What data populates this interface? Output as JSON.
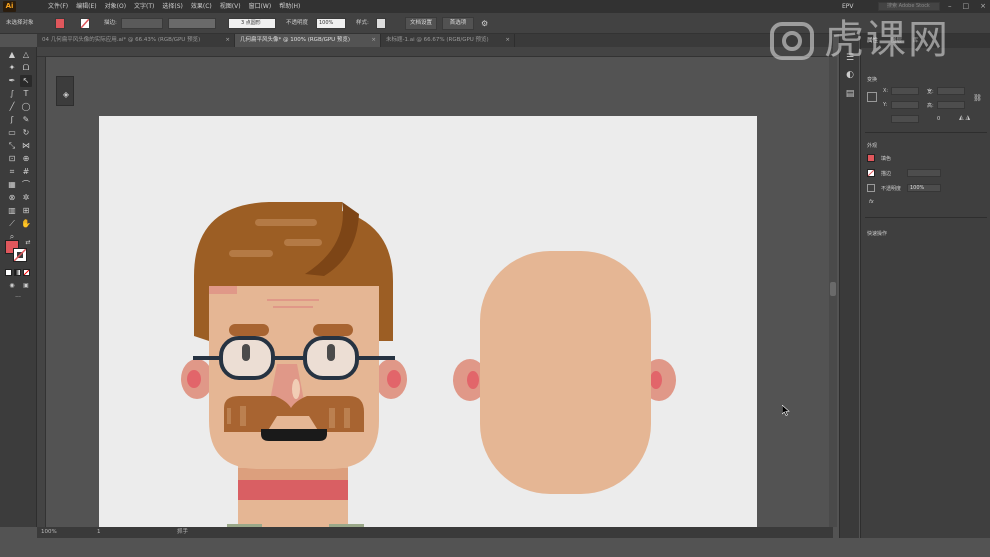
{
  "app": {
    "logo": "Ai"
  },
  "menu": [
    "文件(F)",
    "编辑(E)",
    "对象(O)",
    "文字(T)",
    "选择(S)",
    "效果(C)",
    "视图(V)",
    "窗口(W)",
    "帮助(H)"
  ],
  "workspace": "EPV",
  "search": {
    "placeholder": "搜索 Adobe Stock"
  },
  "window_controls": [
    "–",
    "□",
    "×"
  ],
  "control_bar": {
    "selection_label": "未选择对象",
    "stroke_label": "描边:",
    "stroke_value": "",
    "brush_value": "3 点圆形",
    "opacity_label": "不透明度",
    "opacity_value": "100%",
    "style_label": "样式:",
    "doc_setup": "文档设置",
    "preferences": "首选项"
  },
  "tabs": [
    {
      "label": "04 几何扁平风头像的实际应用.ai* @ 66.43% (RGB/GPU 预览)",
      "close": "×"
    },
    {
      "label": "几何扁平风头像* @ 100% (RGB/GPU 预览)",
      "close": "×"
    },
    {
      "label": "未标题-1.ai @ 66.67% (RGB/GPU 预览)",
      "close": "×"
    }
  ],
  "status": {
    "zoom": "100%",
    "page": "1",
    "tool": "抓手"
  },
  "panel": {
    "tabs": [
      "属性",
      "图层",
      "库"
    ],
    "section_transform": "变换",
    "x_label": "X:",
    "y_label": "Y:",
    "w_label": "宽:",
    "h_label": "高:",
    "angle_value": "0",
    "section_appearance": "外观",
    "fill_label": "填色",
    "stroke_label": "描边",
    "opacity_label": "不透明度",
    "opacity_value": "100%",
    "fx_label": "fx",
    "section_quick_actions": "快速操作"
  },
  "colors": {
    "hair": "#9c5e24",
    "hair_dark": "#7d4516",
    "hair_light": "#b47a45",
    "skin": "#e5b694",
    "skin_shadow": "#dc9f7d",
    "ear_inner": "#e2656a",
    "mustache": "#a86431",
    "glasses": "#263342",
    "neck": "#e08a78",
    "collar": "#d95f63",
    "fill_swatch": "#e0575c",
    "artboard": "#ececec"
  },
  "watermark": "虎课网"
}
